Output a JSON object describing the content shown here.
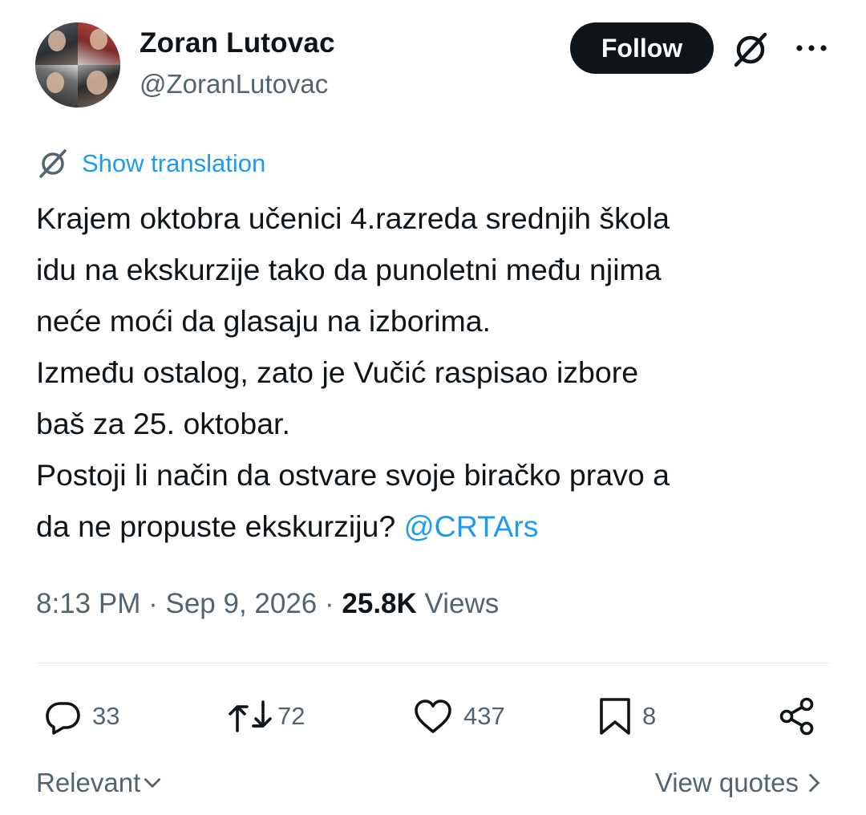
{
  "author": {
    "display_name": "Zoran Lutovac",
    "handle": "@ZoranLutovac",
    "avatar_icon": "profile-collage-avatar"
  },
  "header": {
    "follow_label": "Follow",
    "grok_icon": "grok-icon",
    "more_icon": "more-dots-icon"
  },
  "translation": {
    "label": "Show translation"
  },
  "tweet": {
    "lines": [
      "Krajem oktobra učenici 4.razreda srednjih škola",
      "idu na ekskurzije tako da punoletni među njima",
      "neće moći da glasaju na izborima.",
      "Između ostalog, zato je Vučić raspisao izbore",
      "baš za 25. oktobar.",
      "Postoji li način da ostvare svoje biračko pravo a",
      "da ne propuste ekskurziju?"
    ],
    "mention": "@CRTArs"
  },
  "meta": {
    "time": "8:13 PM",
    "separator": "·",
    "date": "Sep 9, 2026",
    "views_count": "25.8K",
    "views_label": "Views"
  },
  "actions": {
    "replies": "33",
    "reposts": "72",
    "likes": "437",
    "bookmarks": "8"
  },
  "footer": {
    "sort_label": "Relevant",
    "quotes_label": "View quotes"
  },
  "colors": {
    "accent": "#1d9bf0",
    "text": "#0f1419",
    "secondary": "#536471",
    "follow_bg": "#0f1419"
  }
}
